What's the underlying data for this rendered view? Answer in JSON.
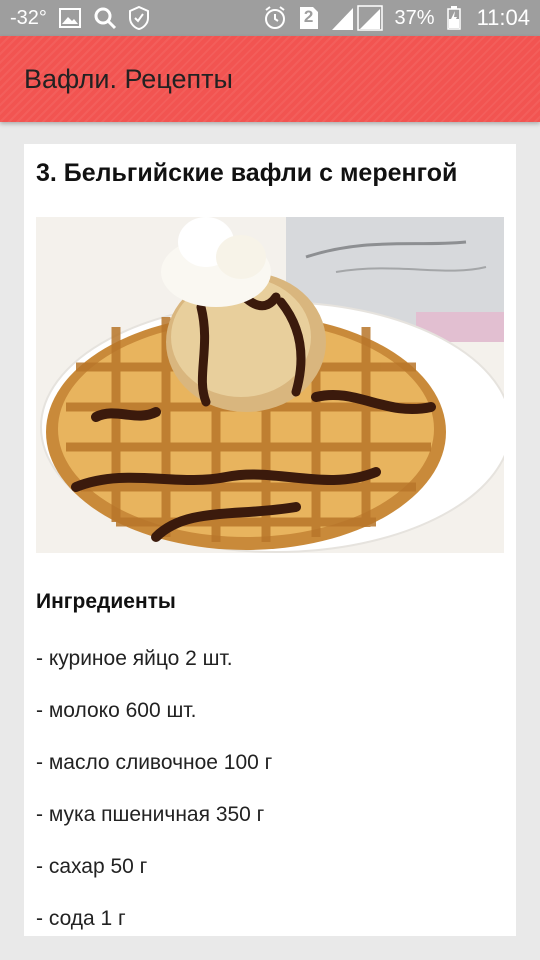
{
  "status_bar": {
    "temperature": "-32°",
    "battery_percent": "37%",
    "sim_badge": "2",
    "time": "11:04",
    "icons": [
      "image-icon",
      "search-icon",
      "shield-icon",
      "alarm-icon",
      "sim-icon",
      "signal-icon",
      "battery-icon"
    ]
  },
  "app_bar": {
    "title": "Вафли. Рецепты",
    "color": "#f25451"
  },
  "recipe": {
    "title": "3. Бельгийские вафли с меренгой",
    "image_alt": "waffle-with-ice-cream",
    "ingredients_heading": "Ингредиенты",
    "ingredients": [
      "- куриное яйцо 2 шт.",
      "- молоко 600 шт.",
      "- масло сливочное 100 г",
      "- мука пшеничная 350 г",
      "- сахар 50 г",
      "- сода 1 г"
    ]
  }
}
